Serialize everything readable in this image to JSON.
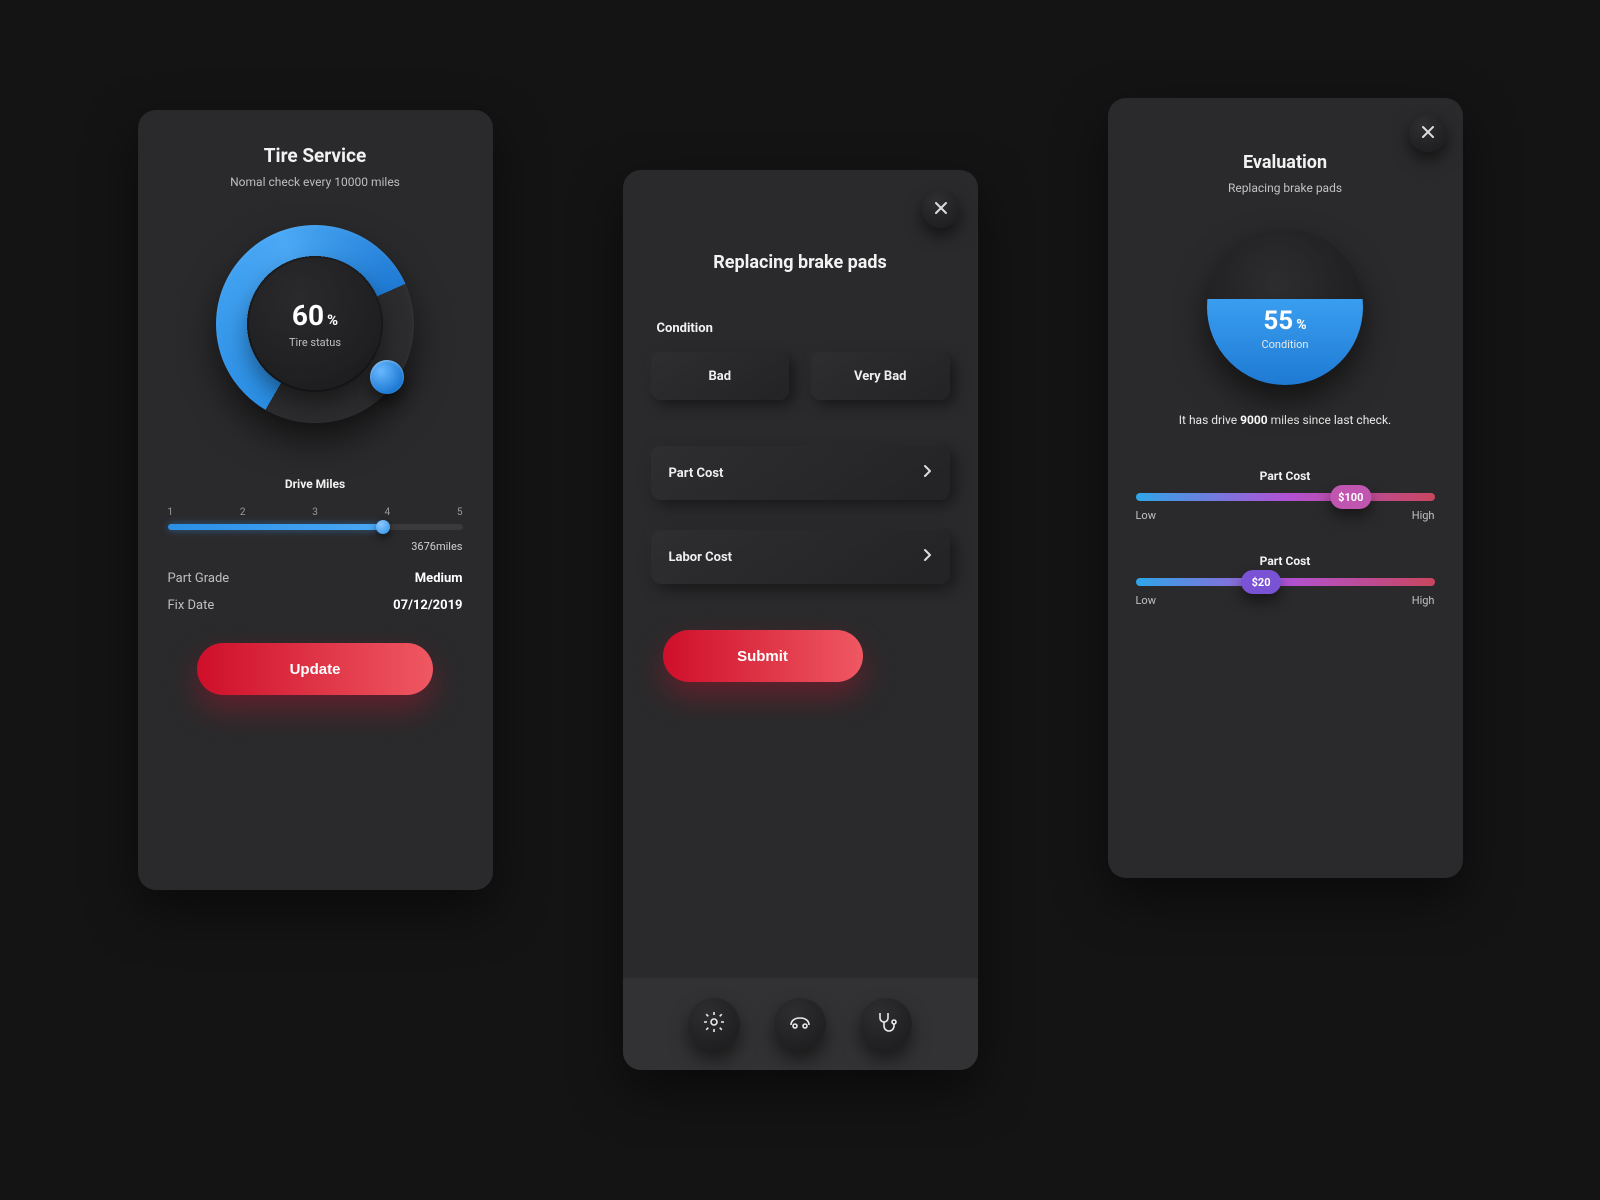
{
  "screen1": {
    "title": "Tire Service",
    "subtitle": "Nomal check every 10000 miles",
    "gauge": {
      "value": "60",
      "pct": "%",
      "label": "Tire status",
      "fill_deg": 216
    },
    "drive_miles": {
      "title": "Drive Miles",
      "ticks": [
        "1",
        "2",
        "3",
        "4",
        "5"
      ],
      "value_label": "3676miles"
    },
    "rows": {
      "part_grade_k": "Part Grade",
      "part_grade_v": "Medium",
      "fix_date_k": "Fix Date",
      "fix_date_v": "07/12/2019"
    },
    "update_btn": "Update"
  },
  "screen2": {
    "title": "Replacing brake pads",
    "condition_label": "Condition",
    "chips": {
      "bad": "Bad",
      "very_bad": "Very Bad"
    },
    "part_cost": "Part Cost",
    "labor_cost": "Labor Cost",
    "submit": "Submit"
  },
  "screen3": {
    "title": "Evaluation",
    "subtitle": "Replacing brake pads",
    "orb": {
      "value": "55",
      "pct": "%",
      "label": "Condition",
      "fill_pct": 55
    },
    "drive_note_pre": "It has drive ",
    "drive_note_bold": "9000",
    "drive_note_post": " miles since last check.",
    "sliders": {
      "a": {
        "title": "Part Cost",
        "value": "$100",
        "low": "Low",
        "high": "High"
      },
      "b": {
        "title": "Part Cost",
        "value": "$20",
        "low": "Low",
        "high": "High"
      }
    }
  },
  "chart_data": [
    {
      "type": "pie",
      "title": "Tire status",
      "values": [
        60,
        40
      ],
      "categories": [
        "filled",
        "remaining"
      ],
      "unit": "%"
    },
    {
      "type": "pie",
      "title": "Condition",
      "values": [
        55,
        45
      ],
      "categories": [
        "filled",
        "remaining"
      ],
      "unit": "%"
    }
  ]
}
